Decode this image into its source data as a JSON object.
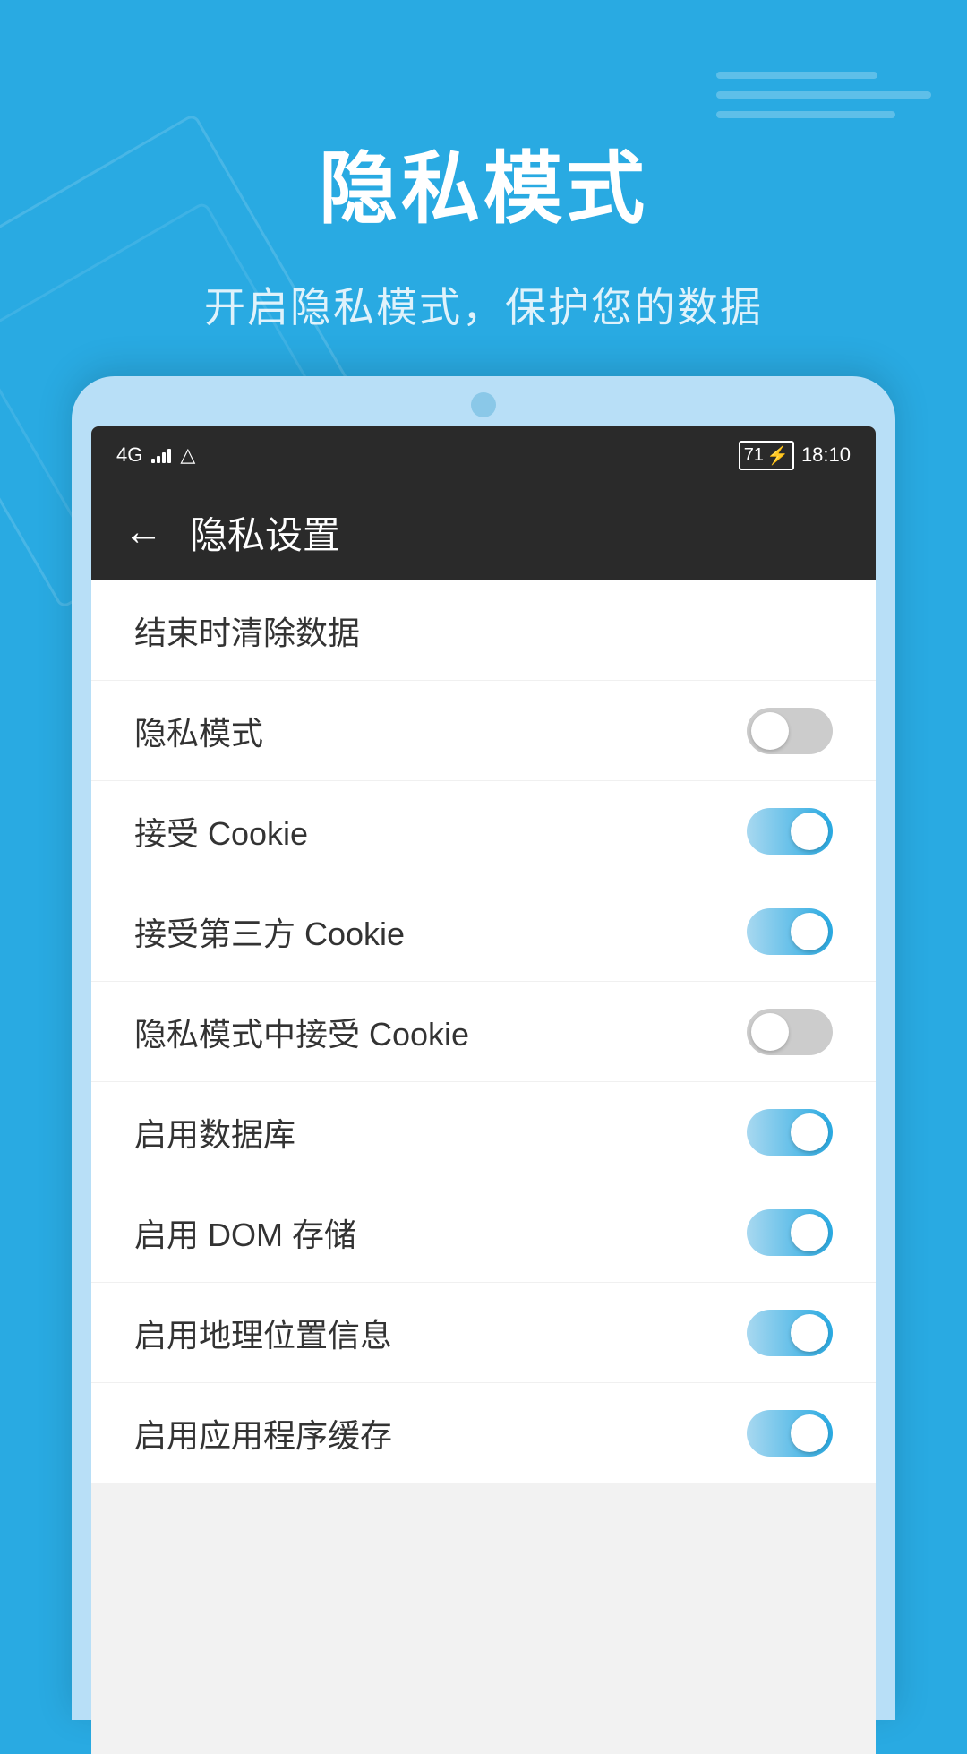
{
  "background": {
    "color": "#29aae2"
  },
  "header": {
    "main_title": "隐私模式",
    "sub_title": "开启隐私模式，保护您的数据"
  },
  "status_bar": {
    "network": "4G",
    "battery": "71",
    "charging": true,
    "time": "18:10"
  },
  "app_header": {
    "back_label": "←",
    "title": "隐私设置"
  },
  "settings": {
    "items": [
      {
        "label": "结束时清除数据",
        "has_toggle": false
      },
      {
        "label": "隐私模式",
        "has_toggle": true,
        "toggle_on": false
      },
      {
        "label": "接受 Cookie",
        "has_toggle": true,
        "toggle_on": true
      },
      {
        "label": "接受第三方 Cookie",
        "has_toggle": true,
        "toggle_on": true
      },
      {
        "label": "隐私模式中接受 Cookie",
        "has_toggle": true,
        "toggle_on": false
      },
      {
        "label": "启用数据库",
        "has_toggle": true,
        "toggle_on": true
      },
      {
        "label": "启用 DOM 存储",
        "has_toggle": true,
        "toggle_on": true
      },
      {
        "label": "启用地理位置信息",
        "has_toggle": true,
        "toggle_on": true
      },
      {
        "label": "启用应用程序缓存",
        "has_toggle": true,
        "toggle_on": true
      }
    ]
  },
  "top_right_deco": {
    "lines": [
      180,
      240,
      200
    ]
  }
}
